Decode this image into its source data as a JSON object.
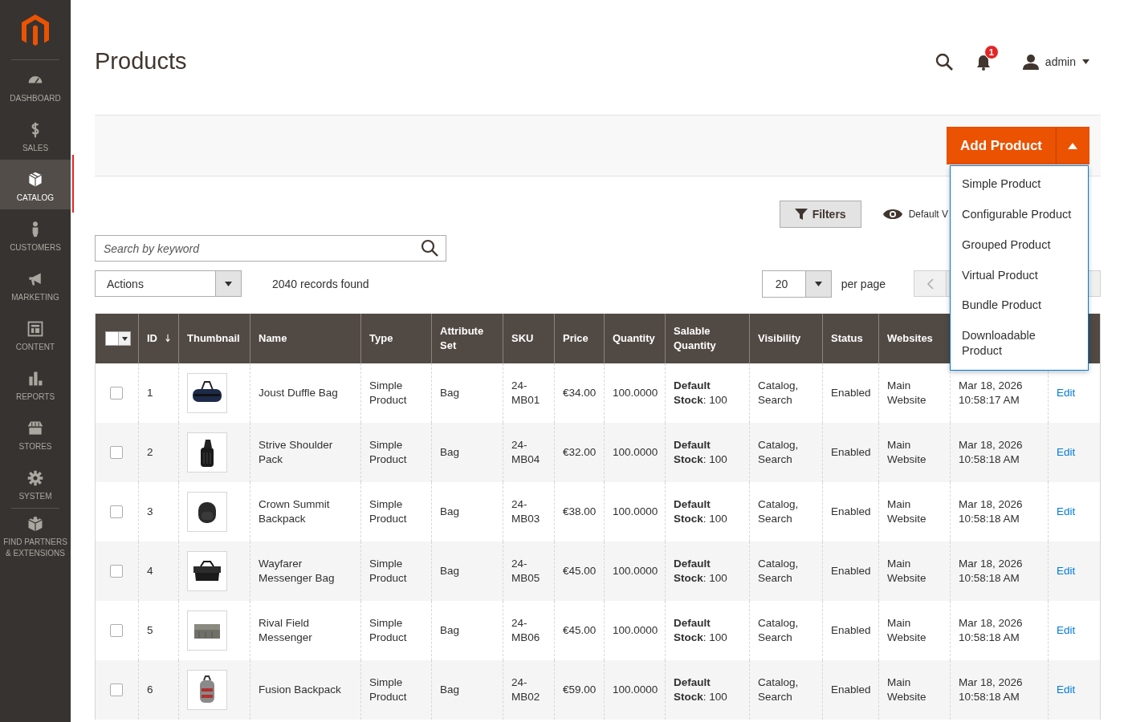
{
  "sidebar": {
    "items": [
      {
        "label": "DASHBOARD",
        "selected": false
      },
      {
        "label": "SALES",
        "selected": false
      },
      {
        "label": "CATALOG",
        "selected": true
      },
      {
        "label": "CUSTOMERS",
        "selected": false
      },
      {
        "label": "MARKETING",
        "selected": false
      },
      {
        "label": "CONTENT",
        "selected": false
      },
      {
        "label": "REPORTS",
        "selected": false
      },
      {
        "label": "STORES",
        "selected": false
      },
      {
        "label": "SYSTEM",
        "selected": false
      },
      {
        "label": "FIND PARTNERS & EXTENSIONS",
        "selected": false
      }
    ]
  },
  "header": {
    "title": "Products",
    "notifications": "1",
    "user": "admin"
  },
  "add_product": {
    "label": "Add Product",
    "expanded": true,
    "menu": [
      "Simple Product",
      "Configurable Product",
      "Grouped Product",
      "Virtual Product",
      "Bundle Product",
      "Downloadable Product"
    ]
  },
  "toolbar": {
    "filters": "Filters",
    "view": "Default V",
    "search": {
      "placeholder": "Search by keyword"
    },
    "mass_action": "Actions",
    "records": "2040 records found",
    "per_page": "20",
    "per_page_label": "per page"
  },
  "table": {
    "columns": [
      "ID",
      "Thumbnail",
      "Name",
      "Type",
      "Attribute Set",
      "SKU",
      "Price",
      "Quantity",
      "Salable Quantity",
      "Visibility",
      "Status",
      "Websites"
    ],
    "rows": [
      {
        "checked": false,
        "id": "1",
        "name": "Joust Duffle Bag",
        "type": "Simple Product",
        "attribute_set": "Bag",
        "sku": "24-MB01",
        "price": "€34.00",
        "quantity": "100.0000",
        "salable": "**Default Stock**: 100",
        "visibility": "Catalog, Search",
        "status": "Enabled",
        "websites": "Main Website",
        "updated": "Mar 18, 2026 10:58:17 AM",
        "action": "Edit"
      },
      {
        "checked": false,
        "id": "2",
        "name": "Strive Shoulder Pack",
        "type": "Simple Product",
        "attribute_set": "Bag",
        "sku": "24-MB04",
        "price": "€32.00",
        "quantity": "100.0000",
        "salable": "**Default Stock**: 100",
        "visibility": "Catalog, Search",
        "status": "Enabled",
        "websites": "Main Website",
        "updated": "Mar 18, 2026 10:58:18 AM",
        "action": "Edit"
      },
      {
        "checked": false,
        "id": "3",
        "name": "Crown Summit Backpack",
        "type": "Simple Product",
        "attribute_set": "Bag",
        "sku": "24-MB03",
        "price": "€38.00",
        "quantity": "100.0000",
        "salable": "**Default Stock**: 100",
        "visibility": "Catalog, Search",
        "status": "Enabled",
        "websites": "Main Website",
        "updated": "Mar 18, 2026 10:58:18 AM",
        "action": "Edit"
      },
      {
        "checked": false,
        "id": "4",
        "name": "Wayfarer Messenger Bag",
        "type": "Simple Product",
        "attribute_set": "Bag",
        "sku": "24-MB05",
        "price": "€45.00",
        "quantity": "100.0000",
        "salable": "**Default Stock**: 100",
        "visibility": "Catalog, Search",
        "status": "Enabled",
        "websites": "Main Website",
        "updated": "Mar 18, 2026 10:58:18 AM",
        "action": "Edit"
      },
      {
        "checked": false,
        "id": "5",
        "name": "Rival Field Messenger",
        "type": "Simple Product",
        "attribute_set": "Bag",
        "sku": "24-MB06",
        "price": "€45.00",
        "quantity": "100.0000",
        "salable": "**Default Stock**: 100",
        "visibility": "Catalog, Search",
        "status": "Enabled",
        "websites": "Main Website",
        "updated": "Mar 18, 2026 10:58:18 AM",
        "action": "Edit"
      },
      {
        "checked": false,
        "id": "6",
        "name": "Fusion Backpack",
        "type": "Simple Product",
        "attribute_set": "Bag",
        "sku": "24-MB02",
        "price": "€59.00",
        "quantity": "100.0000",
        "salable": "**Default Stock**: 100",
        "visibility": "Catalog, Search",
        "status": "Enabled",
        "websites": "Main Website",
        "updated": "Mar 18, 2026 10:58:18 AM",
        "action": "Edit"
      }
    ]
  }
}
